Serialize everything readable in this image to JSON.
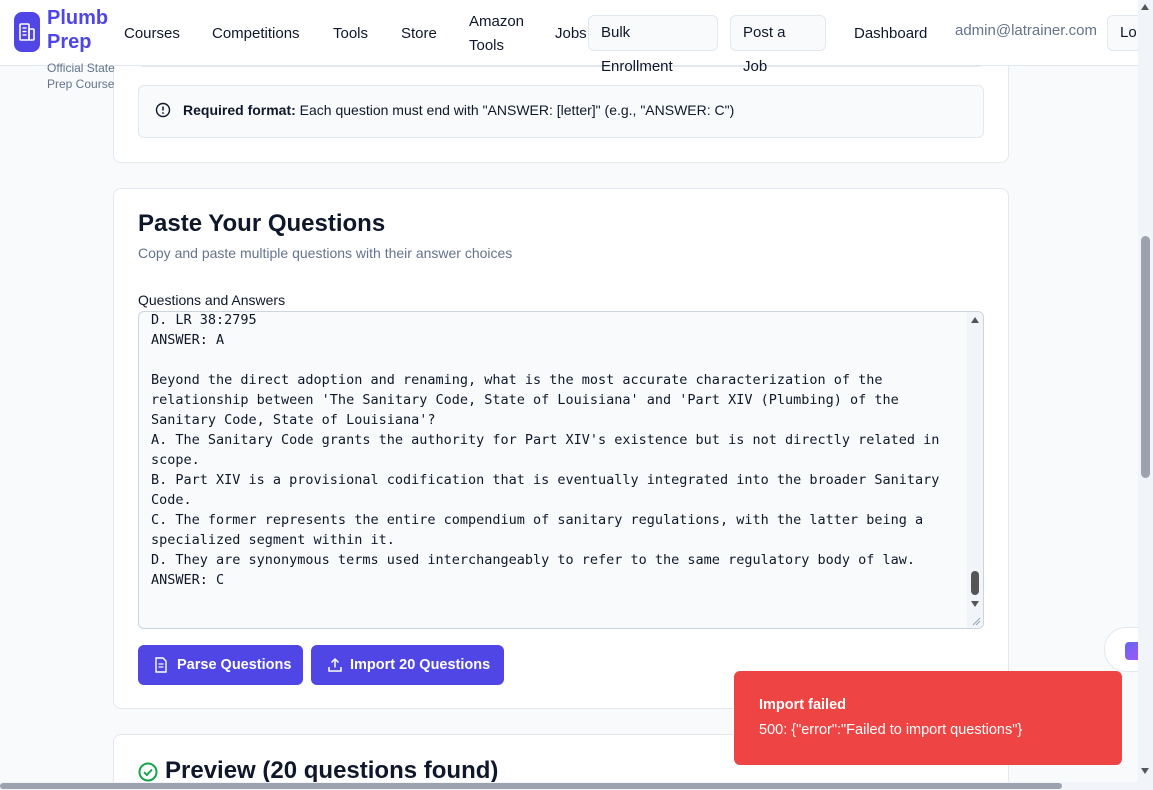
{
  "header": {
    "brand": "Plumb Prep",
    "brand_line1": "Plumb",
    "brand_line2": "Prep",
    "tagline_line1": "Official State",
    "tagline_line2": "Prep Course",
    "nav": {
      "courses": "Courses",
      "competitions": "Competitions",
      "tools": "Tools",
      "store": "Store",
      "amazon_line1": "Amazon",
      "amazon_line2": "Tools",
      "jobs": "Jobs"
    },
    "bulk_enrollment": "Bulk Enrollment",
    "post_job": "Post a Job",
    "dashboard": "Dashboard",
    "email": "admin@latrainer.com",
    "logout": "Lo"
  },
  "notice": {
    "label": "Required format:",
    "text": " Each question must end with \"ANSWER: [letter]\" (e.g., \"ANSWER: C\")"
  },
  "paste_section": {
    "title": "Paste Your Questions",
    "subtitle": "Copy and paste multiple questions with their answer choices",
    "field_label": "Questions and Answers",
    "textarea_value": "D. LR 38:2795\nANSWER: A\n\nBeyond the direct adoption and renaming, what is the most accurate characterization of the relationship between 'The Sanitary Code, State of Louisiana' and 'Part XIV (Plumbing) of the Sanitary Code, State of Louisiana'?\nA. The Sanitary Code grants the authority for Part XIV's existence but is not directly related in scope.\nB. Part XIV is a provisional codification that is eventually integrated into the broader Sanitary Code.\nC. The former represents the entire compendium of sanitary regulations, with the latter being a specialized segment within it.\nD. They are synonymous terms used interchangeably to refer to the same regulatory body of law.\nANSWER: C",
    "parse_button": "Parse Questions",
    "import_button": "Import 20 Questions"
  },
  "preview": {
    "title": "Preview (20 questions found)"
  },
  "toast": {
    "title": "Import failed",
    "message": "500: {\"error\":\"Failed to import questions\"}"
  },
  "colors": {
    "primary": "#4f46e5",
    "danger": "#ef4444",
    "success": "#16a34a"
  }
}
